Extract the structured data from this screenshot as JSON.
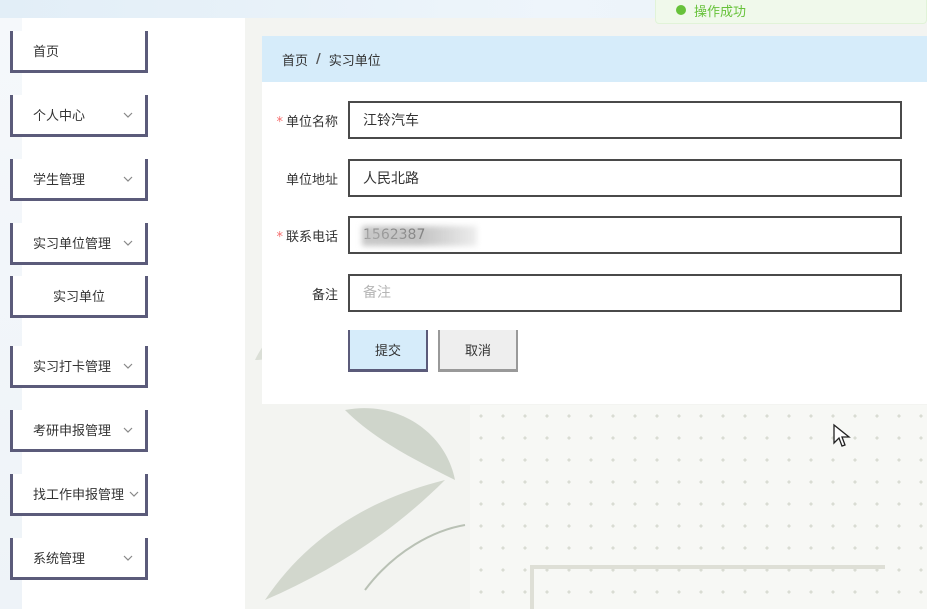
{
  "toast": {
    "message": "操作成功",
    "color": "#67c23a"
  },
  "sidebar": {
    "items": [
      {
        "label": "首页",
        "has_chevron": false
      },
      {
        "label": "个人中心",
        "has_chevron": true
      },
      {
        "label": "学生管理",
        "has_chevron": true
      },
      {
        "label": "实习单位管理",
        "has_chevron": true,
        "expanded": true,
        "children": [
          {
            "label": "实习单位"
          }
        ]
      },
      {
        "label": "实习打卡管理",
        "has_chevron": true
      },
      {
        "label": "考研申报管理",
        "has_chevron": true
      },
      {
        "label": "找工作申报管理",
        "has_chevron": true
      },
      {
        "label": "系统管理",
        "has_chevron": true
      }
    ]
  },
  "breadcrumb": {
    "home": "首页",
    "separator": "/",
    "current": "实习单位"
  },
  "form": {
    "fields": [
      {
        "label": "单位名称",
        "required": true,
        "value": "江铃汽车",
        "placeholder": ""
      },
      {
        "label": "单位地址",
        "required": false,
        "value": "人民北路",
        "placeholder": ""
      },
      {
        "label": "联系电话",
        "required": true,
        "value": "1562387",
        "placeholder": ""
      },
      {
        "label": "备注",
        "required": false,
        "value": "",
        "placeholder": "备注"
      }
    ],
    "submit_label": "提交",
    "cancel_label": "取消"
  },
  "colors": {
    "accent": "#d6ecfa",
    "border": "#5b5b7a",
    "required": "#f56c6c"
  }
}
